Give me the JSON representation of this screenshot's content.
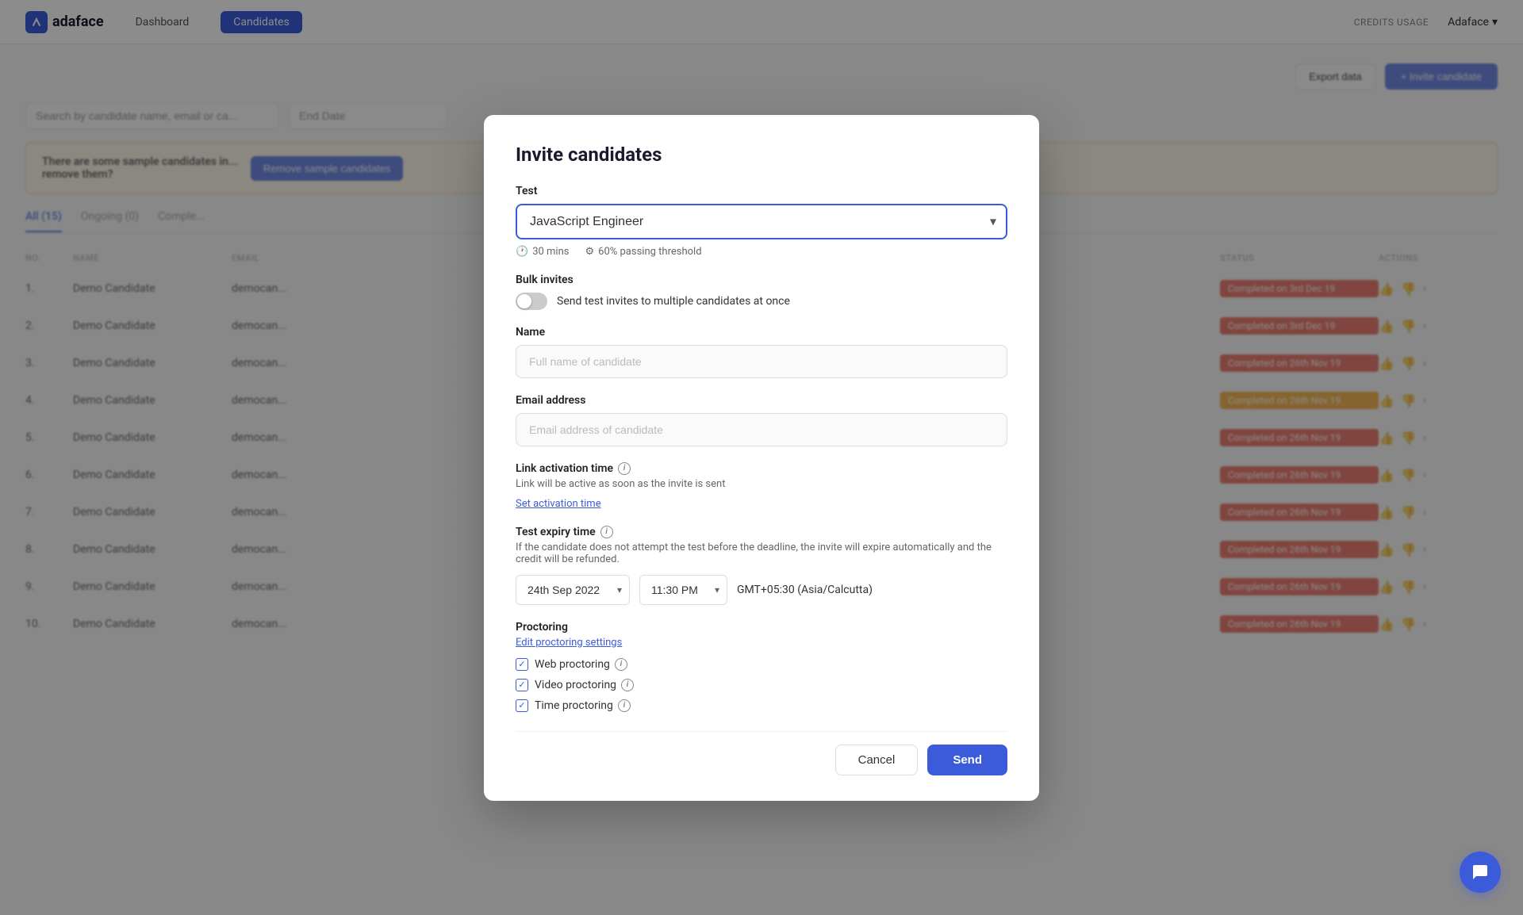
{
  "app": {
    "logo_text": "adaface",
    "logo_icon": "a"
  },
  "nav": {
    "items": [
      {
        "label": "Dashboard",
        "active": false
      },
      {
        "label": "Candidates",
        "active": true
      }
    ],
    "credits_label": "CREDITS USAGE",
    "account_name": "Adaface",
    "account_chevron": "▾"
  },
  "page": {
    "search_placeholder": "Search by candidate name, email or ca...",
    "end_date_placeholder": "End Date",
    "banner_text": "There are some sample candidates in...\nremove them?",
    "banner_line2": "remove them?",
    "remove_btn": "Remove sample candidates",
    "export_btn": "Export data",
    "invite_btn": "+ Invite candidate",
    "tabs": [
      {
        "label": "All (15)",
        "active": true
      },
      {
        "label": "Ongoing (0)",
        "active": false
      },
      {
        "label": "Comple...",
        "active": false
      }
    ],
    "table_headers": [
      "NO.",
      "NAME",
      "EMAIL",
      "",
      "STATUS",
      "ACTIONS"
    ],
    "table_rows": [
      {
        "no": "1.",
        "name": "Demo Candidate",
        "email": "democan...",
        "status": "Completed on 3rd Dec 19",
        "status_color": "red"
      },
      {
        "no": "2.",
        "name": "Demo Candidate",
        "email": "democan...",
        "status": "Completed on 3rd Dec 19",
        "status_color": "red"
      },
      {
        "no": "3.",
        "name": "Demo Candidate",
        "email": "democan...",
        "status": "Completed on 26th Nov 19",
        "status_color": "red"
      },
      {
        "no": "4.",
        "name": "Demo Candidate",
        "email": "democan...",
        "status": "Completed on 26th Nov 19",
        "status_color": "yellow"
      },
      {
        "no": "5.",
        "name": "Demo Candidate",
        "email": "democan...",
        "status": "Completed on 26th Nov 19",
        "status_color": "red"
      },
      {
        "no": "6.",
        "name": "Demo Candidate",
        "email": "democan...",
        "status": "Completed on 26th Nov 19",
        "status_color": "red"
      },
      {
        "no": "7.",
        "name": "Demo Candidate",
        "email": "democan...",
        "status": "Completed on 26th Nov 19",
        "status_color": "red"
      },
      {
        "no": "8.",
        "name": "Demo Candidate",
        "email": "democan...",
        "status": "Completed on 26th Nov 19",
        "status_color": "red"
      },
      {
        "no": "9.",
        "name": "Demo Candidate",
        "email": "democan...",
        "status": "Completed on 26th Nov 19",
        "status_color": "red"
      },
      {
        "no": "10.",
        "name": "Demo Candidate",
        "email": "democan...",
        "status": "Completed on 26th Nov 19",
        "status_color": "red"
      }
    ]
  },
  "modal": {
    "title": "Invite candidates",
    "test_label": "Test",
    "test_value": "JavaScript Engineer",
    "test_duration": "30 mins",
    "test_threshold": "60% passing threshold",
    "bulk_label": "Bulk invites",
    "bulk_desc": "Send test invites to multiple candidates at once",
    "name_label": "Name",
    "name_placeholder": "Full name of candidate",
    "email_label": "Email address",
    "email_placeholder": "Email address of candidate",
    "activation_title": "Link activation time",
    "activation_desc": "Link will be active as soon as the invite is sent",
    "set_activation_link": "Set activation time",
    "expiry_title": "Test expiry time",
    "expiry_desc": "If the candidate does not attempt the test before the deadline, the invite will expire automatically and the credit will be refunded.",
    "expiry_date": "24th Sep 2022",
    "expiry_time": "11:30 PM",
    "timezone": "GMT+05:30 (Asia/Calcutta)",
    "proctoring_title": "Proctoring",
    "edit_proctoring_link": "Edit proctoring settings",
    "proctoring_options": [
      {
        "label": "Web proctoring",
        "checked": true
      },
      {
        "label": "Video proctoring",
        "checked": true
      },
      {
        "label": "Time proctoring",
        "checked": true
      }
    ],
    "cancel_btn": "Cancel",
    "send_btn": "Send"
  }
}
